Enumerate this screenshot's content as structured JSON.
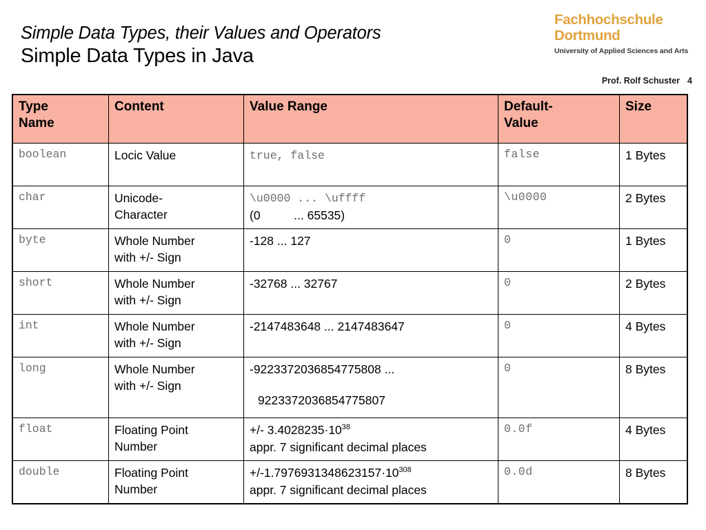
{
  "header": {
    "subtitle": "Simple Data Types, their Values and Operators",
    "title": "Simple Data Types in Java",
    "logo_line1": "Fachhochschule",
    "logo_line2": "Dortmund",
    "logo_tagline": "University of Applied Sciences and Arts",
    "author": "Prof. Rolf Schuster",
    "page_number": "4",
    "accent_color": "#E2A33C",
    "header_row_color": "#F9B2A2"
  },
  "table": {
    "columns": [
      {
        "label": "Type\nName",
        "label_line1": "Type",
        "label_line2": "Name"
      },
      {
        "label": "Content"
      },
      {
        "label": "Value Range"
      },
      {
        "label_line1": "Default-",
        "label_line2": "Value"
      },
      {
        "label": "Size"
      }
    ],
    "headers": {
      "type_name_l1": "Type",
      "type_name_l2": "Name",
      "content": "Content",
      "value_range": "Value Range",
      "default_l1": "Default-",
      "default_l2": "Value",
      "size": "Size"
    },
    "rows": [
      {
        "type": "boolean",
        "content_l1": "Locic Value",
        "content_l2": "",
        "range_l1": "true, false",
        "range_l2": "",
        "range_mono": true,
        "default": "false",
        "size": "1 Bytes"
      },
      {
        "type": "char",
        "content_l1": "Unicode-",
        "content_l2": "Character",
        "range_l1": "\\u0000 ... \\uffff",
        "range_l2": "(0          ... 65535)",
        "range_mono": "mixed",
        "default": "\\u0000",
        "size": "2 Bytes"
      },
      {
        "type": "byte",
        "content_l1": "Whole Number",
        "content_l2": "with +/- Sign",
        "range_l1": "-128 ... 127",
        "range_l2": "",
        "range_mono": false,
        "default": "0",
        "size": "1 Bytes"
      },
      {
        "type": "short",
        "content_l1": "Whole Number",
        "content_l2": "with +/- Sign",
        "range_l1": "-32768 ... 32767",
        "range_l2": "",
        "range_mono": false,
        "default": "0",
        "size": "2 Bytes"
      },
      {
        "type": "int",
        "content_l1": "Whole Number",
        "content_l2": "with +/- Sign",
        "range_l1": "-2147483648 ... 2147483647",
        "range_l2": "",
        "range_mono": false,
        "default": "0",
        "size": "4 Bytes"
      },
      {
        "type": "long",
        "content_l1": "Whole Number",
        "content_l2": "with +/- Sign",
        "range_l1": "-9223372036854775808 ...",
        "range_l2": "9223372036854775807",
        "range_mono": false,
        "default": "0",
        "size": "8 Bytes"
      },
      {
        "type": "float",
        "content_l1": "Floating Point",
        "content_l2": "Number",
        "range_mantissa": "+/- 3.4028235·10",
        "range_exponent": "38",
        "range_l2": "appr. 7 significant decimal places",
        "range_mono": false,
        "default": "0.0f",
        "size": "4 Bytes"
      },
      {
        "type": "double",
        "content_l1": "Floating Point",
        "content_l2": "Number",
        "range_mantissa": "+/-1.7976931348623157·10",
        "range_exponent": "308",
        "range_l2": "appr. 7 significant decimal places",
        "range_mono": false,
        "default": "0.0d",
        "size": "8 Bytes"
      }
    ]
  }
}
